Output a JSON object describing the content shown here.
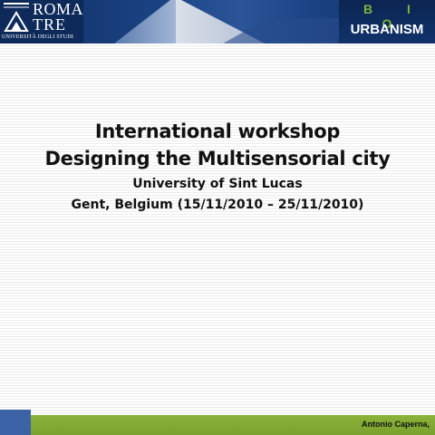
{
  "header": {
    "logo": {
      "line1": "ROMA",
      "line2": "TRE",
      "subtitle": "UNIVERSITÀ DEGLI STUDI"
    },
    "brand": {
      "top": "B I O",
      "bottom": "URBANISM"
    }
  },
  "slide": {
    "title_line1": "International workshop",
    "title_line2": "Designing the Multisensorial city",
    "subtitle_line1": "University of Sint Lucas",
    "subtitle_line2": "Gent, Belgium (15/11/2010 – 25/11/2010)"
  },
  "footer": {
    "author": "Antonio Caperna,"
  },
  "colors": {
    "header_blue": "#1b4384",
    "brand_green": "#7fb23a",
    "footer_green": "#8bb33a",
    "footer_blue": "#3c63a6"
  }
}
